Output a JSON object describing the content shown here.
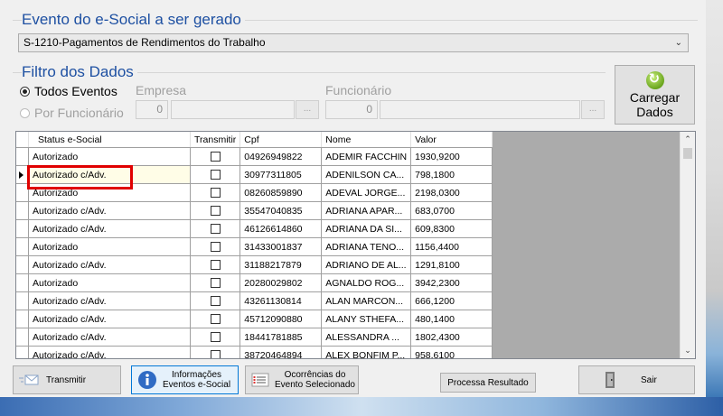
{
  "evento_group": {
    "title": "Evento do e-Social a ser gerado",
    "selected": "S-1210-Pagamentos de Rendimentos do Trabalho"
  },
  "filtro_group": {
    "title": "Filtro dos Dados",
    "radio_todos": "Todos Eventos",
    "radio_funcionario": "Por Funcionário",
    "empresa_label": "Empresa",
    "empresa_value": "0",
    "funcionario_label": "Funcionário",
    "funcionario_value": "0",
    "dots": "..."
  },
  "carregar": {
    "line1": "Carregar",
    "line2": "Dados"
  },
  "grid": {
    "columns": [
      "Status e-Social",
      "Transmitir",
      "Cpf",
      "Nome",
      "Valor"
    ],
    "rows": [
      {
        "status": "Autorizado",
        "cpf": "04926949822",
        "nome": "ADEMIR FACCHIN",
        "valor": "1930,9200"
      },
      {
        "status": "Autorizado c/Adv.",
        "cpf": "30977311805",
        "nome": "ADENILSON CA...",
        "valor": "798,1800"
      },
      {
        "status": "Autorizado",
        "cpf": "08260859890",
        "nome": "ADEVAL JORGE...",
        "valor": "2198,0300"
      },
      {
        "status": "Autorizado c/Adv.",
        "cpf": "35547040835",
        "nome": "ADRIANA APAR...",
        "valor": "683,0700"
      },
      {
        "status": "Autorizado c/Adv.",
        "cpf": "46126614860",
        "nome": "ADRIANA DA SI...",
        "valor": "609,8300"
      },
      {
        "status": "Autorizado",
        "cpf": "31433001837",
        "nome": "ADRIANA TENO...",
        "valor": "1156,4400"
      },
      {
        "status": "Autorizado c/Adv.",
        "cpf": "31188217879",
        "nome": "ADRIANO DE AL...",
        "valor": "1291,8100"
      },
      {
        "status": "Autorizado",
        "cpf": "20280029802",
        "nome": "AGNALDO ROG...",
        "valor": "3942,2300"
      },
      {
        "status": "Autorizado c/Adv.",
        "cpf": "43261130814",
        "nome": "ALAN MARCON...",
        "valor": "666,1200"
      },
      {
        "status": "Autorizado c/Adv.",
        "cpf": "45712090880",
        "nome": "ALANY STHEFA...",
        "valor": "480,1400"
      },
      {
        "status": "Autorizado c/Adv.",
        "cpf": "18441781885",
        "nome": "ALESSANDRA ...",
        "valor": "1802,4300"
      },
      {
        "status": "Autorizado c/Adv.",
        "cpf": "38720464894",
        "nome": "ALEX BONFIM P...",
        "valor": "958,6100"
      }
    ]
  },
  "buttons": {
    "transmitir": "Transmitir",
    "informacoes_1": "Informações",
    "informacoes_2": "Eventos e-Social",
    "ocorrencias_1": "Ocorrências do",
    "ocorrencias_2": "Evento Selecionado",
    "processa": "Processa Resultado",
    "sair": "Sair"
  }
}
